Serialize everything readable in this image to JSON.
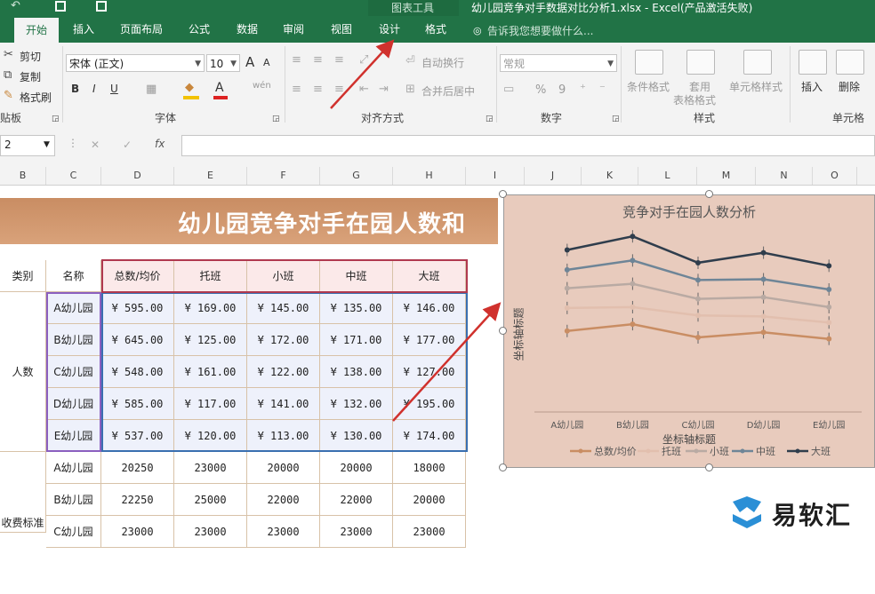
{
  "app": {
    "quick_access_hint": "",
    "chart_tools_label": "图表工具",
    "window_title": "幼儿园竞争对手数据对比分析1.xlsx - Excel(产品激活失败)"
  },
  "tabs": [
    {
      "label": "开始",
      "active": true
    },
    {
      "label": "插入"
    },
    {
      "label": "页面布局"
    },
    {
      "label": "公式"
    },
    {
      "label": "数据"
    },
    {
      "label": "审阅"
    },
    {
      "label": "视图"
    },
    {
      "label": "设计"
    },
    {
      "label": "格式"
    }
  ],
  "tell_me": "告诉我您想要做什么...",
  "ribbon": {
    "clipboard": {
      "cut": "剪切",
      "copy": "复制",
      "format_painter": "格式刷",
      "group": "贴板"
    },
    "font": {
      "name": "宋体 (正文)",
      "size": "10",
      "grow": "A",
      "shrink": "A",
      "bold": "B",
      "italic": "I",
      "underline": "U",
      "color_a": "A",
      "wen": "wén",
      "group": "字体"
    },
    "alignment": {
      "wrap": "自动换行",
      "merge": "合并后居中",
      "group": "对齐方式"
    },
    "number": {
      "format": "常规",
      "percent": "%",
      "comma": "9",
      "group": "数字"
    },
    "styles": {
      "conditional": "条件格式",
      "table1": "套用",
      "table2": "表格格式",
      "cell_styles": "单元格样式",
      "group": "样式"
    },
    "cells": {
      "insert": "插入",
      "delete": "删除",
      "group": "单元格"
    }
  },
  "formula_bar": {
    "name_box": "2",
    "cancel": "✕",
    "enter": "✓",
    "fx": "fx",
    "value": ""
  },
  "columns": [
    "B",
    "C",
    "D",
    "E",
    "F",
    "G",
    "H",
    "I",
    "J",
    "K",
    "L",
    "M",
    "N",
    "O"
  ],
  "sheet": {
    "banner": "幼儿园竞争对手在园人数和",
    "header": [
      "类别",
      "名称",
      "总数/均价",
      "托班",
      "小班",
      "中班",
      "大班"
    ],
    "group1_label": "人数",
    "group2_label": "收费标准",
    "rows_money": [
      {
        "name": "A幼儿园",
        "vals": [
          "¥ 595.00",
          "¥ 169.00",
          "¥ 145.00",
          "¥ 135.00",
          "¥ 146.00"
        ]
      },
      {
        "name": "B幼儿园",
        "vals": [
          "¥ 645.00",
          "¥ 125.00",
          "¥ 172.00",
          "¥ 171.00",
          "¥ 177.00"
        ]
      },
      {
        "name": "C幼儿园",
        "vals": [
          "¥ 548.00",
          "¥ 161.00",
          "¥ 122.00",
          "¥ 138.00",
          "¥ 127.00"
        ]
      },
      {
        "name": "D幼儿园",
        "vals": [
          "¥ 585.00",
          "¥ 117.00",
          "¥ 141.00",
          "¥ 132.00",
          "¥ 195.00"
        ]
      },
      {
        "name": "E幼儿园",
        "vals": [
          "¥ 537.00",
          "¥ 120.00",
          "¥ 113.00",
          "¥ 130.00",
          "¥ 174.00"
        ]
      }
    ],
    "rows_fee": [
      {
        "name": "A幼儿园",
        "vals": [
          "20250",
          "23000",
          "20000",
          "20000",
          "18000"
        ]
      },
      {
        "name": "B幼儿园",
        "vals": [
          "22250",
          "25000",
          "22000",
          "22000",
          "20000"
        ]
      },
      {
        "name": "C幼儿园",
        "vals": [
          "23000",
          "23000",
          "23000",
          "23000",
          "23000"
        ]
      }
    ]
  },
  "chart_data": {
    "type": "line",
    "title": "竞争对手在园人数分析",
    "xlabel": "坐标轴标题",
    "ylabel": "坐标轴标题",
    "categories": [
      "A幼儿园",
      "B幼儿园",
      "C幼儿园",
      "D幼儿园",
      "E幼儿园"
    ],
    "stacked": true,
    "error_bars": true,
    "legend_position": "bottom",
    "series": [
      {
        "name": "总数/均价",
        "color": "#c98d63",
        "values": [
          595,
          645,
          548,
          585,
          537
        ]
      },
      {
        "name": "托班",
        "color": "#e2bfae",
        "values": [
          169,
          125,
          161,
          117,
          120
        ]
      },
      {
        "name": "小班",
        "color": "#b9aaa3",
        "values": [
          145,
          172,
          122,
          141,
          113
        ]
      },
      {
        "name": "中班",
        "color": "#6e8597",
        "values": [
          135,
          171,
          138,
          132,
          130
        ]
      },
      {
        "name": "大班",
        "color": "#2f3d4c",
        "values": [
          146,
          177,
          127,
          195,
          174
        ]
      }
    ]
  },
  "watermark": {
    "text": "易软汇"
  }
}
